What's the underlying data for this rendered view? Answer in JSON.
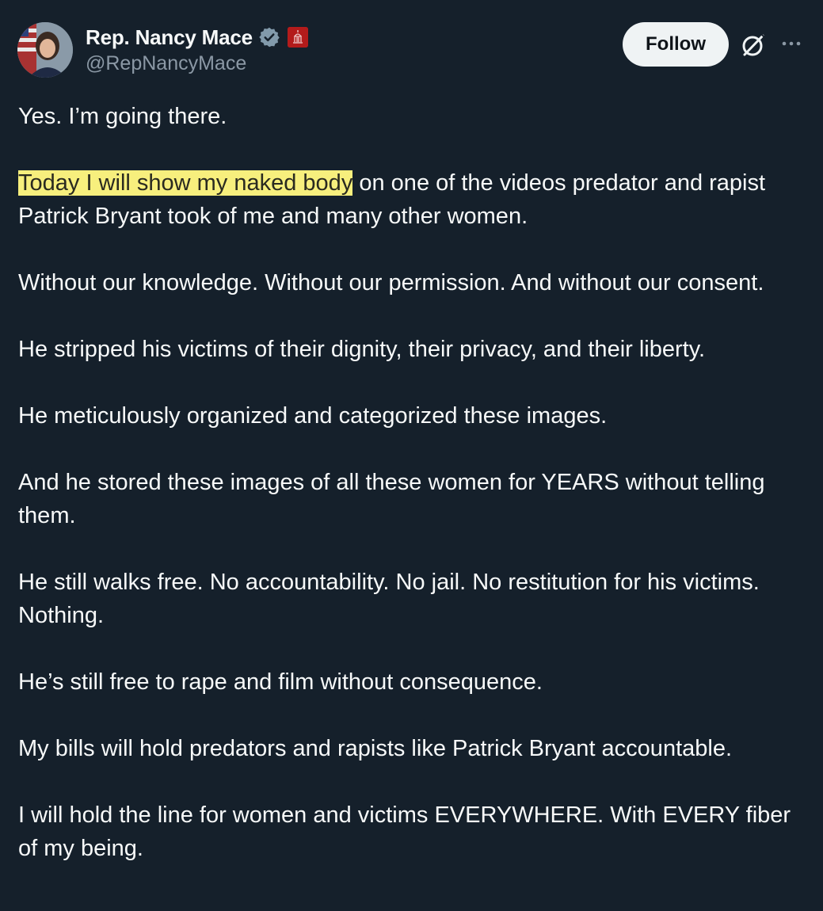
{
  "author": {
    "display_name": "Rep. Nancy Mace",
    "handle": "@RepNancyMace",
    "verified": true,
    "affiliation_badge": "gov-badge-icon"
  },
  "actions": {
    "follow_label": "Follow",
    "grok_icon": "grok-icon",
    "more_icon": "more-options-icon"
  },
  "post": {
    "paragraphs": [
      {
        "text": "Yes. I’m going there."
      },
      {
        "highlight": "Today I will show my naked body",
        "text": " on one of the videos predator and rapist Patrick Bryant took of me and many other women."
      },
      {
        "text": "Without our knowledge. Without our permission. And without our consent."
      },
      {
        "text": "He stripped his victims of their dignity, their privacy, and their liberty."
      },
      {
        "text": "He meticulously organized and categorized these images."
      },
      {
        "text": "And he stored these images of all these women for YEARS without telling them."
      },
      {
        "text": "He still walks free. No accountability. No jail. No restitution for his victims. Nothing."
      },
      {
        "text": "He’s still free to rape and film without consequence."
      },
      {
        "text": "My bills will hold predators and rapists like Patrick Bryant accountable."
      },
      {
        "text": "I will hold the line for women and victims EVERYWHERE. With EVERY fiber of my being."
      }
    ]
  },
  "colors": {
    "background": "#15202b",
    "text": "#f7f9f9",
    "secondary_text": "#8b98a5",
    "highlight": "#f7ef7d",
    "verified_badge": "#829aab"
  }
}
